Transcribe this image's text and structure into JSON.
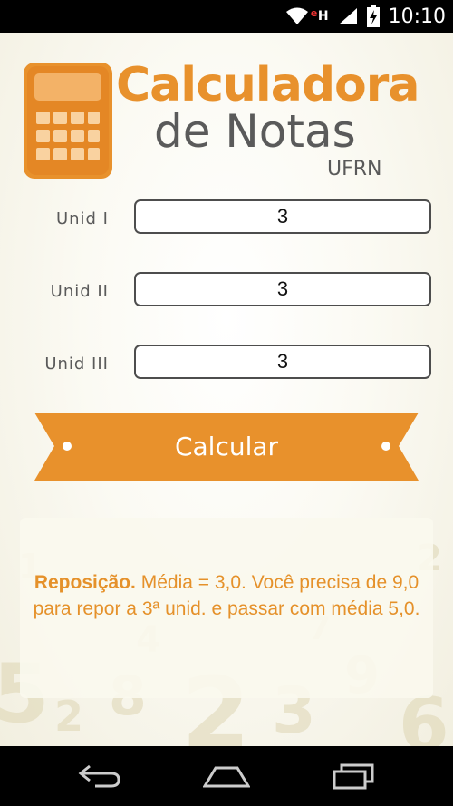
{
  "status_bar": {
    "time": "10:10",
    "data_indicator": "H",
    "data_indicator_prefix": "e",
    "icons": [
      "wifi-icon",
      "signal-icon",
      "battery-charging-icon"
    ]
  },
  "logo": {
    "title_line1": "Calculadora",
    "title_line2": "de Notas",
    "subtitle": "UFRN",
    "icon": "calculator-icon"
  },
  "form": {
    "unit1": {
      "label": "Unid I",
      "value": "3"
    },
    "unit2": {
      "label": "Unid II",
      "value": "3"
    },
    "unit3": {
      "label": "Unid III",
      "value": "3"
    }
  },
  "calculate_button": {
    "label": "Calcular"
  },
  "result": {
    "status": "Reposição.",
    "message": "Média = 3,0. Você precisa de 9,0 para repor a 3ª unid. e passar com média 5,0."
  },
  "navigation": {
    "buttons": [
      "back-icon",
      "home-icon",
      "recent-apps-icon"
    ]
  },
  "colors": {
    "accent": "#e8912c",
    "text_gray": "#5a5a5a",
    "result_text": "#e5912a"
  }
}
